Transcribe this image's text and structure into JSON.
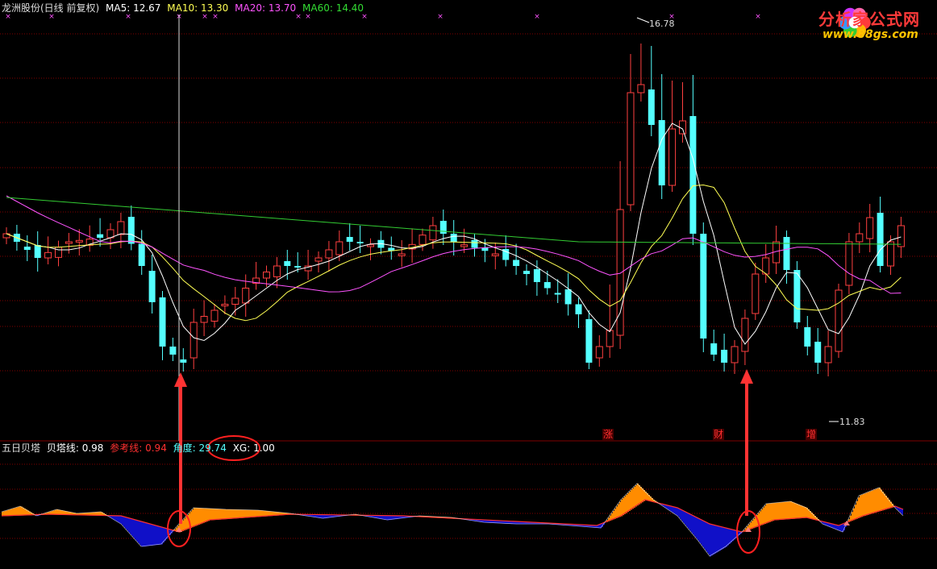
{
  "header": {
    "stock": "龙洲股份(日线 前复权)",
    "ma5": "MA5: 12.67",
    "ma10": "MA10: 13.30",
    "ma20": "MA20: 13.70",
    "ma60": "MA60: 14.40"
  },
  "indicator_header": {
    "name": "五日贝塔",
    "beta": "贝塔线: 0.98",
    "ref": "参考线: 0.94",
    "angle": "角度: 29.74",
    "xg": "XG: 1.00"
  },
  "annotations": {
    "high_label": "16.78",
    "low_label": "11.83",
    "flags": [
      "涨",
      "财",
      "增"
    ]
  },
  "logo": {
    "title": "分析家公式网",
    "url": "www.88gs.com"
  },
  "colors": {
    "up": "#ff4040",
    "down": "#54ffff",
    "ma5": "#ffffff",
    "ma10": "#ffff54",
    "ma20": "#ff54ff",
    "ma60": "#33cc33",
    "area_up": "#ff8c00",
    "area_down": "#1010c8",
    "grid": "#800000",
    "arrow": "#ff3333"
  }
}
